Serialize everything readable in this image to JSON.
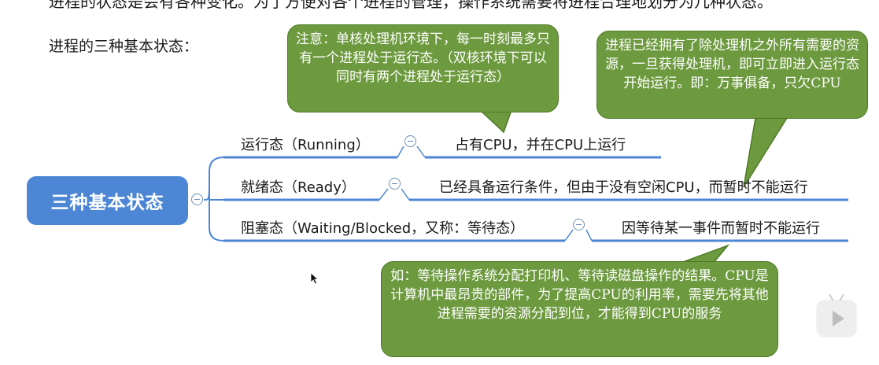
{
  "intro_text": "进程的状态是会有各种变化。为了方便对各个进程的管理，操作系统需要将进程合理地划分为几种状态。",
  "heading": "进程的三种基本状态：",
  "root": {
    "label": "三种基本状态"
  },
  "states": [
    {
      "label": "运行态（Running）",
      "description": "占有CPU，并在CPU上运行"
    },
    {
      "label": "就绪态（Ready）",
      "description": "已经具备运行条件，但由于没有空闲CPU，而暂时不能运行"
    },
    {
      "label": "阻塞态（Waiting/Blocked，又称：等待态）",
      "description": "因等待某一事件而暂时不能运行"
    }
  ],
  "notes": {
    "running": "注意：单核处理机环境下，每一时刻最多只有一个进程处于运行态。（双核环境下可以同时有两个进程处于运行态）",
    "ready": "进程已经拥有了除处理机之外所有需要的资源，一旦获得处理机，即可立即进入运行态开始运行。即：万事俱备，只欠CPU",
    "blocked": "如：等待操作系统分配打印机、等待读磁盘操作的结果。CPU是计算机中最昂贵的部件，为了提高CPU的利用率，需要先将其他进程需要的资源分配到位，才能得到CPU的服务"
  },
  "colors": {
    "root": "#4c86d4",
    "connector": "#4c86d4",
    "note": "#6d9a3e"
  }
}
